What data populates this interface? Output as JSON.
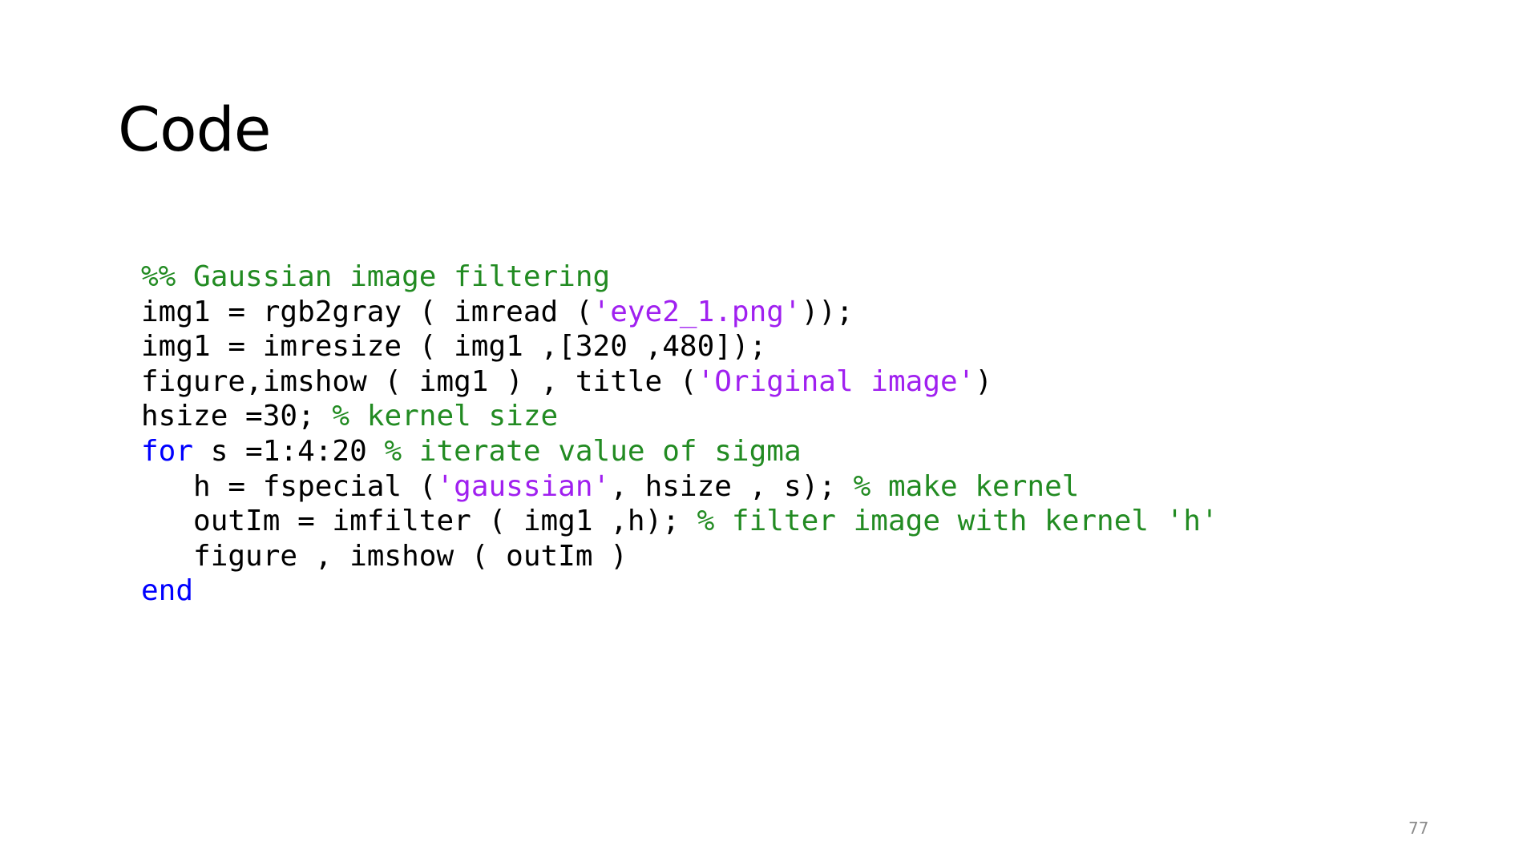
{
  "slide": {
    "title": "Code",
    "page_number": "77"
  },
  "colors": {
    "plain": "#000000",
    "keyword": "#0000ff",
    "string": "#a020f0",
    "comment": "#228b22",
    "page_number": "#8c8c8c"
  },
  "code": {
    "language": "MATLAB",
    "lines": [
      {
        "tokens": [
          {
            "type": "comment",
            "text": "%% Gaussian image filtering"
          }
        ]
      },
      {
        "tokens": [
          {
            "type": "plain",
            "text": "img1 = rgb2gray ( imread ("
          },
          {
            "type": "string",
            "text": "'eye2_1.png'"
          },
          {
            "type": "plain",
            "text": "));"
          }
        ]
      },
      {
        "tokens": [
          {
            "type": "plain",
            "text": "img1 = imresize ( img1 ,[320 ,480]);"
          }
        ]
      },
      {
        "tokens": [
          {
            "type": "plain",
            "text": "figure,imshow ( img1 ) , title ("
          },
          {
            "type": "string",
            "text": "'Original image'"
          },
          {
            "type": "plain",
            "text": ")"
          }
        ]
      },
      {
        "tokens": [
          {
            "type": "plain",
            "text": "hsize =30; "
          },
          {
            "type": "comment",
            "text": "% kernel size"
          }
        ]
      },
      {
        "tokens": [
          {
            "type": "keyword",
            "text": "for"
          },
          {
            "type": "plain",
            "text": " s =1:4:20 "
          },
          {
            "type": "comment",
            "text": "% iterate value of sigma"
          }
        ]
      },
      {
        "tokens": [
          {
            "type": "plain",
            "text": "   h = fspecial ("
          },
          {
            "type": "string",
            "text": "'gaussian'"
          },
          {
            "type": "plain",
            "text": ", hsize , s); "
          },
          {
            "type": "comment",
            "text": "% make kernel"
          }
        ]
      },
      {
        "tokens": [
          {
            "type": "plain",
            "text": "   outIm = imfilter ( img1 ,h); "
          },
          {
            "type": "comment",
            "text": "% filter image with kernel 'h'"
          }
        ]
      },
      {
        "tokens": [
          {
            "type": "plain",
            "text": "   figure , imshow ( outIm )"
          }
        ]
      },
      {
        "tokens": [
          {
            "type": "keyword",
            "text": "end"
          }
        ]
      }
    ]
  }
}
